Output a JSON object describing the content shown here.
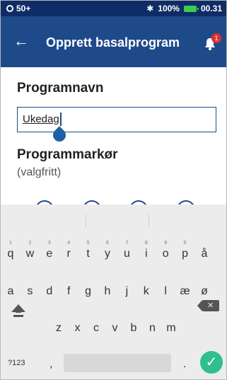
{
  "status_bar": {
    "notif_count": "50+",
    "battery": "100%",
    "time": "00.31"
  },
  "header": {
    "title": "Opprett basalprogram",
    "bell_badge": "1"
  },
  "form": {
    "program_name_label": "Programnavn",
    "program_name_value": "Ukedag",
    "program_marker_label": "Programmarkør",
    "optional_label": "(valgfritt)"
  },
  "keyboard": {
    "row1": [
      "q",
      "w",
      "e",
      "r",
      "t",
      "y",
      "u",
      "i",
      "o",
      "p",
      "å"
    ],
    "row1_hints": [
      "1",
      "2",
      "3",
      "4",
      "5",
      "6",
      "7",
      "8",
      "9",
      "0",
      ""
    ],
    "row2": [
      "a",
      "s",
      "d",
      "f",
      "g",
      "h",
      "j",
      "k",
      "l",
      "æ",
      "ø"
    ],
    "row3": [
      "z",
      "x",
      "c",
      "v",
      "b",
      "n",
      "m"
    ],
    "mode_key": "?123",
    "comma_key": ",",
    "period_key": "."
  },
  "colors": {
    "status_bar": "#0e2c66",
    "app_bar": "#1f4a8a",
    "done_key": "#2fbf8f",
    "badge": "#e03030"
  }
}
